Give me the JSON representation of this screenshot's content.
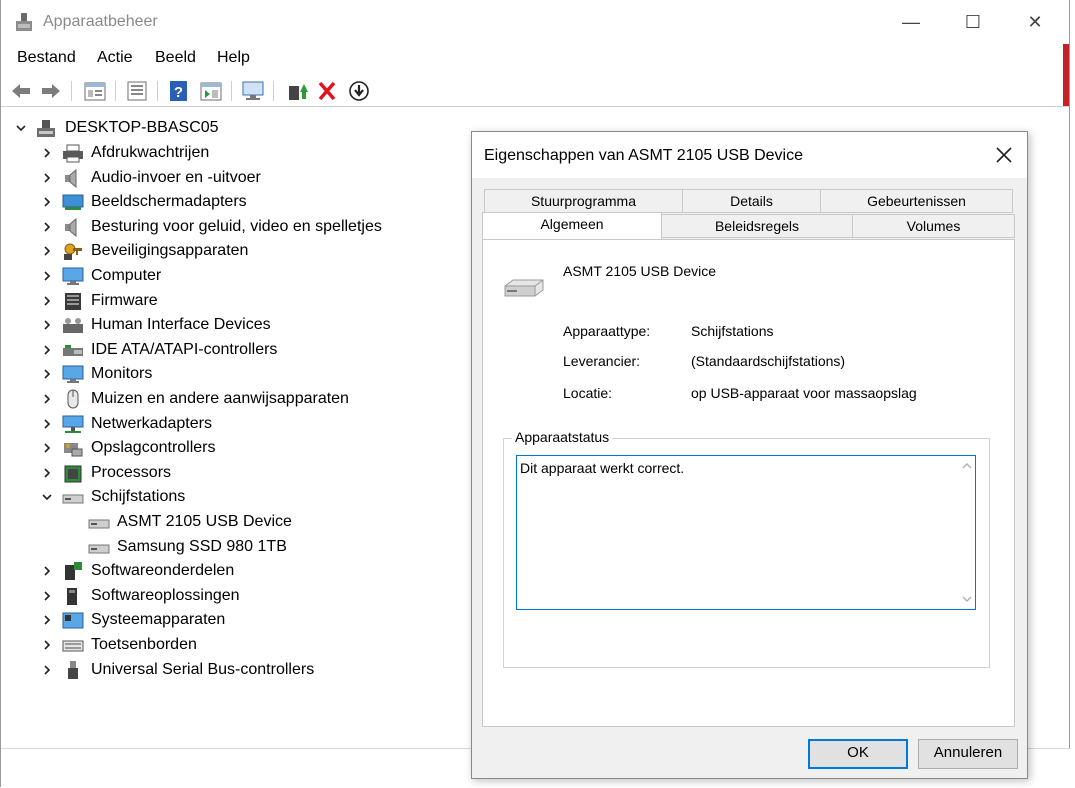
{
  "window": {
    "title": "Apparaatbeheer",
    "minimize": "—",
    "maximize": "☐",
    "close": "✕"
  },
  "menu": [
    "Bestand",
    "Actie",
    "Beeld",
    "Help"
  ],
  "toolbar": {
    "icons": [
      "back-arrow-icon",
      "forward-arrow-icon",
      "properties-icon",
      "tree-view-icon",
      "help-icon",
      "details-view-icon",
      "scan-hardware-icon",
      "update-driver-icon",
      "uninstall-icon",
      "disable-icon"
    ]
  },
  "tree": {
    "root": "DESKTOP-BBASC05",
    "categories": [
      {
        "label": "Afdrukwachtrijen",
        "icon": "printer-icon"
      },
      {
        "label": "Audio-invoer en -uitvoer",
        "icon": "speaker-icon"
      },
      {
        "label": "Beeldschermadapters",
        "icon": "display-adapter-icon"
      },
      {
        "label": "Besturing voor geluid, video en spelletjes",
        "icon": "speaker-icon"
      },
      {
        "label": "Beveiligingsapparaten",
        "icon": "security-key-icon"
      },
      {
        "label": "Computer",
        "icon": "computer-icon"
      },
      {
        "label": "Firmware",
        "icon": "firmware-icon"
      },
      {
        "label": "Human Interface Devices",
        "icon": "hid-icon"
      },
      {
        "label": "IDE ATA/ATAPI-controllers",
        "icon": "ide-controller-icon"
      },
      {
        "label": "Monitors",
        "icon": "monitor-icon"
      },
      {
        "label": "Muizen en andere aanwijsapparaten",
        "icon": "mouse-icon"
      },
      {
        "label": "Netwerkadapters",
        "icon": "network-adapter-icon"
      },
      {
        "label": "Opslagcontrollers",
        "icon": "storage-controller-icon"
      },
      {
        "label": "Processors",
        "icon": "processor-icon"
      },
      {
        "label": "Schijfstations",
        "icon": "disk-drive-icon",
        "expanded": true,
        "children": [
          "ASMT 2105 USB Device",
          "Samsung SSD 980 1TB"
        ]
      },
      {
        "label": "Softwareonderdelen",
        "icon": "software-component-icon"
      },
      {
        "label": "Softwareoplossingen",
        "icon": "software-device-icon"
      },
      {
        "label": "Systeemapparaten",
        "icon": "system-device-icon"
      },
      {
        "label": "Toetsenborden",
        "icon": "keyboard-icon"
      },
      {
        "label": "Universal Serial Bus-controllers",
        "icon": "usb-icon"
      }
    ]
  },
  "dialog": {
    "title": "Eigenschappen van ASMT 2105 USB Device",
    "tabs_back": [
      "Stuurprogramma",
      "Details",
      "Gebeurtenissen"
    ],
    "tabs_front": [
      "Algemeen",
      "Beleidsregels",
      "Volumes"
    ],
    "active_tab": "Algemeen",
    "device_name": "ASMT 2105 USB Device",
    "props": [
      {
        "label": "Apparaattype:",
        "value": "Schijfstations"
      },
      {
        "label": "Leverancier:",
        "value": "(Standaardschijfstations)"
      },
      {
        "label": "Locatie:",
        "value": "op USB-apparaat voor massaopslag"
      }
    ],
    "status_group": "Apparaatstatus",
    "status_text": "Dit apparaat werkt correct.",
    "ok": "OK",
    "cancel": "Annuleren"
  },
  "colors": {
    "accent": "#0078d7",
    "brand_red": "#c4212b"
  }
}
